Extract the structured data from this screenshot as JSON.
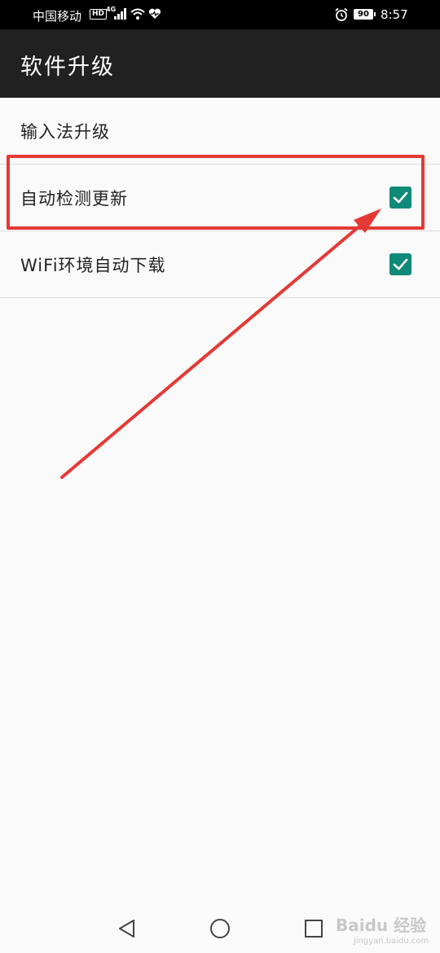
{
  "status_bar": {
    "carrier": "中国移动",
    "hd_badge": "HD",
    "network_type": "4G",
    "battery_level": "90",
    "time": "8:57"
  },
  "app_bar": {
    "title": "软件升级"
  },
  "settings": [
    {
      "label": "输入法升级",
      "has_checkbox": false
    },
    {
      "label": "自动检测更新",
      "has_checkbox": true,
      "checked": true
    },
    {
      "label": "WiFi环境自动下载",
      "has_checkbox": true,
      "checked": true
    }
  ],
  "colors": {
    "accent": "#0f8a78",
    "annotation": "#e53935",
    "app_bar_bg": "#212121"
  },
  "nav_bar": {
    "icons": [
      "back-icon",
      "home-icon",
      "recents-icon"
    ]
  },
  "watermark": {
    "logo_text": "Baidu 经验",
    "url": "jingyan.baidu.com"
  }
}
